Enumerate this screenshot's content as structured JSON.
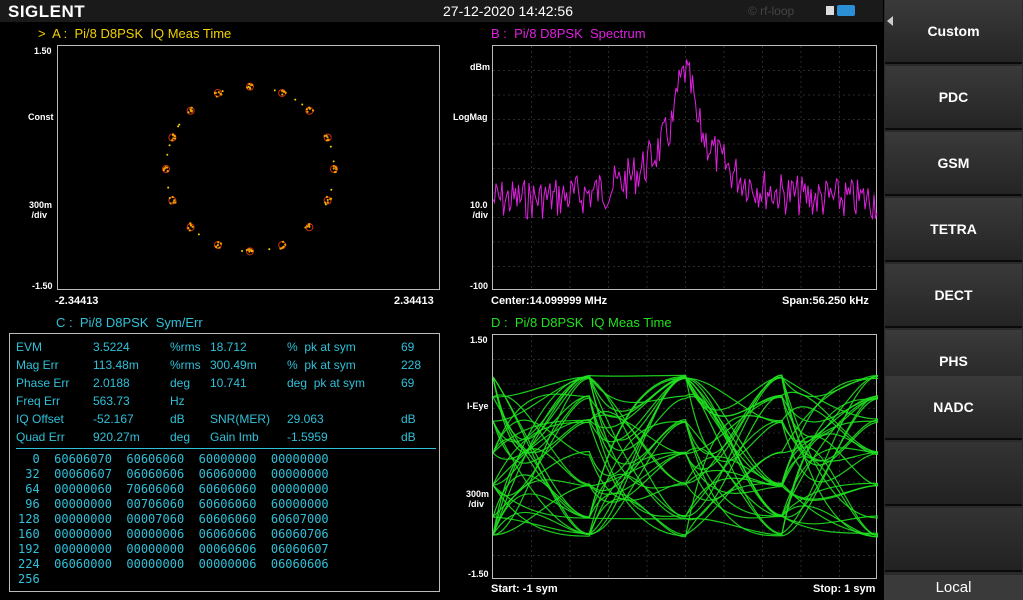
{
  "header": {
    "brand": "SIGLENT",
    "datetime": "27-12-2020 14:42:56",
    "watermark": "© rf-loop"
  },
  "panel_a": {
    "title": ">  A :  Pi/8 D8PSK  IQ Meas Time",
    "y_top": "1.50",
    "y_mode": "Const",
    "y_scale": "300m\n /div",
    "y_bottom": "-1.50",
    "x_left": "-2.34413",
    "x_right": "2.34413"
  },
  "panel_b": {
    "title": "B :  Pi/8 D8PSK  Spectrum",
    "y_unit": "dBm",
    "y_mode": "LogMag",
    "y_scale": "10.0\n /div",
    "y_bottom": "-100",
    "center": "Center:14.099999 MHz",
    "span": "Span:56.250 kHz"
  },
  "panel_c": {
    "title": "C :  Pi/8 D8PSK  Sym/Err",
    "metrics": [
      {
        "c1": "EVM",
        "c2": "3.5224",
        "c3": "%rms",
        "c4": "18.712",
        "c5": "%  pk at sym",
        "c6": "69"
      },
      {
        "c1": "Mag Err",
        "c2": "113.48m",
        "c3": "%rms",
        "c4": "300.49m",
        "c5": "%  pk at sym",
        "c6": "228"
      },
      {
        "c1": "Phase Err",
        "c2": "2.0188",
        "c3": "deg",
        "c4": "10.741",
        "c5": "deg  pk at sym",
        "c6": "69"
      },
      {
        "c1": "Freq Err",
        "c2": "563.73",
        "c3": "Hz",
        "c4": "",
        "c5": "",
        "c6": ""
      },
      {
        "c1": "IQ Offset",
        "c2": "-52.167",
        "c3": "dB",
        "c4": "SNR(MER)",
        "c5": "29.063",
        "c6": "dB"
      },
      {
        "c1": "Quad Err",
        "c2": "920.27m",
        "c3": "deg",
        "c4": "Gain Imb",
        "c5": "-1.5959",
        "c6": "dB"
      }
    ],
    "symbols": [
      "  0  60606070  60606060  60000000  00000000",
      " 32  00060607  06060606  06060000  00000000",
      " 64  00000060  70606060  60606060  00000000",
      " 96  00000000  00706060  60606060  60000000",
      "128  00000000  00007060  60606060  60607000",
      "160  00000000  00000006  06060606  06060706",
      "192  00000000  00000000  00060606  06060607",
      "224  06060000  00000000  00000006  06060606",
      "256"
    ]
  },
  "panel_d": {
    "title": "D :  Pi/8 D8PSK  IQ Meas Time",
    "y_top": "1.50",
    "y_mode": "I-Eye",
    "y_scale": "300m\n /div",
    "y_bottom": "-1.50",
    "start": "Start: -1 sym",
    "stop": "Stop: 1 sym"
  },
  "sidebar": {
    "items": [
      {
        "label": "Custom"
      },
      {
        "label": "PDC"
      },
      {
        "label": "GSM"
      },
      {
        "label": "TETRA"
      },
      {
        "label": "DECT"
      },
      {
        "label": "PHS"
      },
      {
        "label": "NADC"
      }
    ],
    "local_label": "Local"
  },
  "colors": {
    "trace_a": "#f0a000",
    "trace_b": "#e020e0",
    "trace_d": "#20e020",
    "table_text": "#30c0d8"
  }
}
